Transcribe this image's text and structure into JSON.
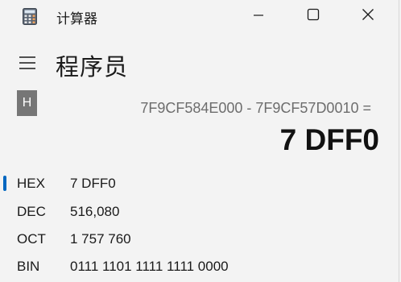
{
  "window": {
    "title": "计算器",
    "icon": "calculator-icon",
    "controls": [
      "minimize-icon",
      "maximize-icon",
      "close-icon"
    ]
  },
  "header": {
    "menu_icon": "hamburger-icon",
    "mode": "程序员"
  },
  "memory_badge": {
    "label": "H"
  },
  "display": {
    "expression": "7F9CF584E000 - 7F9CF57D0010 =",
    "result": "7 DFF0"
  },
  "radix": [
    {
      "label": "HEX",
      "value": "7 DFF0",
      "selected": true
    },
    {
      "label": "DEC",
      "value": "516,080",
      "selected": false
    },
    {
      "label": "OCT",
      "value": "1 757 760",
      "selected": false
    },
    {
      "label": "BIN",
      "value": "0111 1101 1111 1111 0000",
      "selected": false
    }
  ],
  "colors": {
    "accent": "#0067c0",
    "background": "#f3f3f3",
    "badge": "#767676"
  }
}
